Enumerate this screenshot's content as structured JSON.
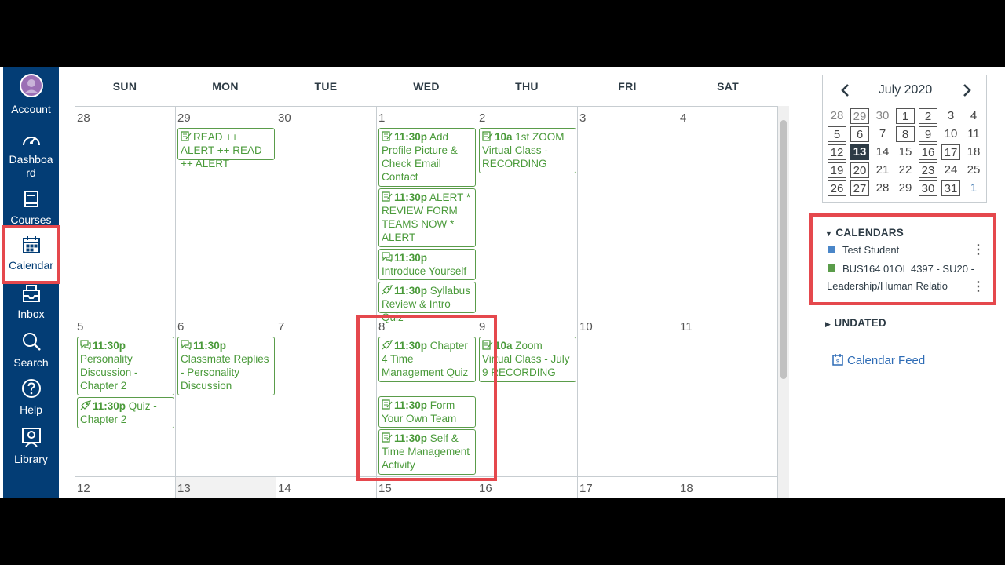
{
  "nav": {
    "items": [
      {
        "label": "Account",
        "icon": "account-avatar-icon"
      },
      {
        "label": "Dashboard",
        "icon": "dashboard-gauge-icon"
      },
      {
        "label": "Courses",
        "icon": "courses-book-icon"
      },
      {
        "label": "Calendar",
        "icon": "calendar-icon"
      },
      {
        "label": "Inbox",
        "icon": "inbox-tray-icon"
      },
      {
        "label": "Search",
        "icon": "search-magnifier-icon"
      },
      {
        "label": "Help",
        "icon": "help-question-icon"
      },
      {
        "label": "Library",
        "icon": "library-icon"
      }
    ],
    "active_index": 3
  },
  "calendar": {
    "day_headers": [
      "SUN",
      "MON",
      "TUE",
      "WED",
      "THU",
      "FRI",
      "SAT"
    ],
    "weeks": [
      {
        "days": [
          "28",
          "29",
          "30",
          "1",
          "2",
          "3",
          "4"
        ],
        "events": [
          {
            "day": 1,
            "time": "",
            "title": "READ ++ ALERT ++ READ ++ ALERT",
            "icon": "assignment-icon"
          },
          {
            "day": 3,
            "time": "11:30p",
            "title": "Add Profile Picture & Check Email Contact",
            "icon": "assignment-icon"
          },
          {
            "day": 3,
            "time": "11:30p",
            "title": "ALERT * REVIEW FORM TEAMS NOW * ALERT",
            "icon": "assignment-icon"
          },
          {
            "day": 3,
            "time": "11:30p",
            "title": "Introduce Yourself",
            "icon": "discussion-icon"
          },
          {
            "day": 3,
            "time": "11:30p",
            "title": "Syllabus Review & Intro Quiz",
            "icon": "quiz-rocket-icon"
          },
          {
            "day": 4,
            "time": "10a",
            "title": "1st ZOOM Virtual Class - RECORDING",
            "icon": "assignment-icon"
          }
        ]
      },
      {
        "days": [
          "5",
          "6",
          "7",
          "8",
          "9",
          "10",
          "11"
        ],
        "events": [
          {
            "day": 0,
            "time": "11:30p",
            "title": "Personality Discussion - Chapter 2",
            "icon": "discussion-icon"
          },
          {
            "day": 0,
            "time": "11:30p",
            "title": "Quiz - Chapter 2",
            "icon": "quiz-rocket-icon"
          },
          {
            "day": 1,
            "time": "11:30p",
            "title": "Classmate Replies - Personality Discussion",
            "icon": "discussion-icon"
          },
          {
            "day": 3,
            "time": "11:30p",
            "title": "Chapter 4 Time Management Quiz",
            "icon": "quiz-rocket-icon"
          },
          {
            "day": 3,
            "time": "11:30p",
            "title": "Form Your Own Team",
            "icon": "assignment-icon"
          },
          {
            "day": 3,
            "time": "11:30p",
            "title": "Self & Time Management Activity",
            "icon": "assignment-icon"
          },
          {
            "day": 4,
            "time": "10a",
            "title": "Zoom Virtual Class - July 9 RECORDING",
            "icon": "assignment-icon"
          }
        ]
      },
      {
        "days": [
          "12",
          "13",
          "14",
          "15",
          "16",
          "17",
          "18"
        ],
        "events": []
      }
    ]
  },
  "mini": {
    "title": "July 2020",
    "prev": "‹",
    "next": "›",
    "rows": [
      [
        "28",
        "29",
        "30",
        "1",
        "2",
        "3",
        "4"
      ],
      [
        "5",
        "6",
        "7",
        "8",
        "9",
        "10",
        "11"
      ],
      [
        "12",
        "13",
        "14",
        "15",
        "16",
        "17",
        "18"
      ],
      [
        "19",
        "20",
        "21",
        "22",
        "23",
        "24",
        "25"
      ],
      [
        "26",
        "27",
        "28",
        "29",
        "30",
        "31",
        "1"
      ]
    ]
  },
  "calendars": {
    "heading": "CALENDARS",
    "items": [
      {
        "label": "Test Student",
        "color": "#4a86c8"
      },
      {
        "label_line1": "BUS164 01OL 4397 - SU20 -",
        "label_line2": "Leadership/Human Relatio",
        "color": "#5a9c4a"
      }
    ],
    "undated": "UNDATED",
    "feed": "Calendar Feed"
  },
  "colors": {
    "nav": "#033d75",
    "event": "#4a9a3a",
    "highlight": "#e5484d"
  }
}
